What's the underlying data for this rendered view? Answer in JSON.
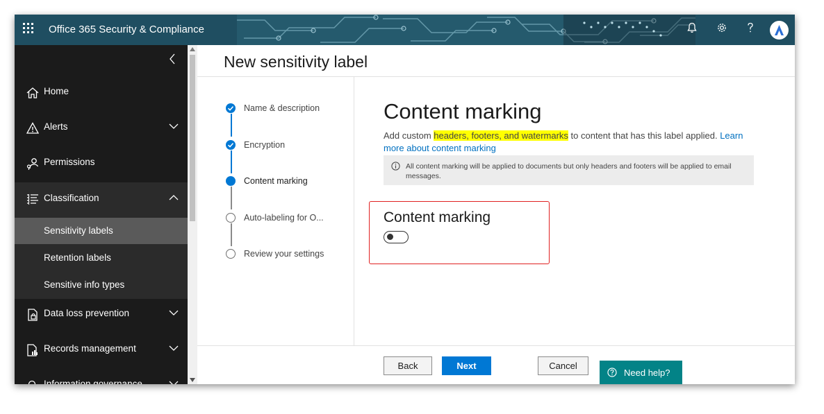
{
  "app": {
    "title": "Office 365 Security & Compliance"
  },
  "topbar": {
    "icons": [
      "waffle-icon",
      "bell-icon",
      "gear-icon",
      "help-icon",
      "avatar"
    ]
  },
  "sidebar": {
    "items": [
      {
        "label": "Home",
        "icon": "home-icon"
      },
      {
        "label": "Alerts",
        "icon": "alert-icon",
        "expandable": true
      },
      {
        "label": "Permissions",
        "icon": "permissions-icon"
      },
      {
        "label": "Classification",
        "icon": "classification-icon",
        "expanded": true
      },
      {
        "label": "Data loss prevention",
        "icon": "dlp-icon",
        "expandable": true
      },
      {
        "label": "Records management",
        "icon": "records-icon",
        "expandable": true
      },
      {
        "label": "Information governance",
        "icon": "governance-icon",
        "expandable": true
      }
    ],
    "subitems": [
      {
        "label": "Sensitivity labels",
        "selected": true
      },
      {
        "label": "Retention labels"
      },
      {
        "label": "Sensitive info types"
      }
    ]
  },
  "page": {
    "title": "New sensitivity label"
  },
  "steps": [
    {
      "label": "Name & description",
      "state": "done"
    },
    {
      "label": "Encryption",
      "state": "done"
    },
    {
      "label": "Content marking",
      "state": "current"
    },
    {
      "label": "Auto-labeling for O...",
      "state": "todo"
    },
    {
      "label": "Review your settings",
      "state": "todo"
    }
  ],
  "content": {
    "heading": "Content marking",
    "desc_pre": "Add custom ",
    "desc_highlight": "headers, footers, and watermarks",
    "desc_post": " to content that has this label applied. ",
    "desc_link": "Learn more about content marking",
    "info_text": "All content marking will be applied to documents but only headers and footers will be applied to email messages.",
    "toggle_label": "Content marking",
    "toggle_on": false
  },
  "buttons": {
    "back": "Back",
    "next": "Next",
    "cancel": "Cancel",
    "help": "Need help?"
  },
  "colors": {
    "topbar": "#1f4e61",
    "sidebar": "#1b1b1b",
    "accent": "#0078d4",
    "help": "#038387",
    "highlight_border": "#e02020"
  }
}
